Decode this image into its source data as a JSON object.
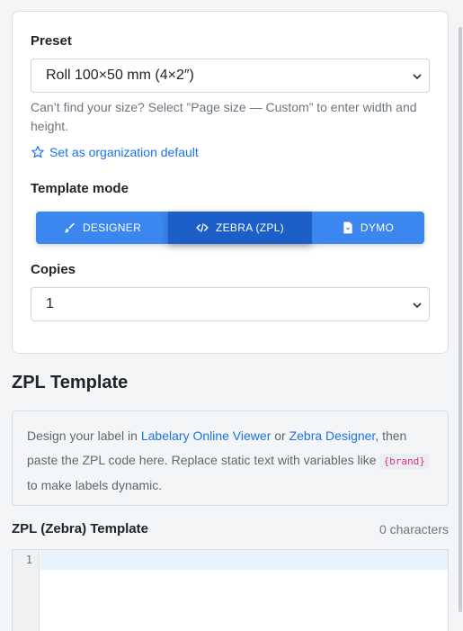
{
  "preset": {
    "label": "Preset",
    "selected": "Roll 100×50 mm (4×2″)",
    "help": "Can’t find your size? Select ”Page size — Custom” to enter width and height.",
    "default_link": "Set as organization default"
  },
  "template_mode": {
    "label": "Template mode",
    "options": [
      {
        "label": "DESIGNER",
        "icon": "brush-icon"
      },
      {
        "label": "ZEBRA (ZPL)",
        "icon": "code-icon"
      },
      {
        "label": "DYMO",
        "icon": "file-icon"
      }
    ],
    "active_index": 1
  },
  "copies": {
    "label": "Copies",
    "selected": "1"
  },
  "zpl_section": {
    "title": "ZPL Template",
    "info_pre": "Design your label in ",
    "link1": "Labelary Online Viewer",
    "info_mid": " or ",
    "link2": "Zebra Designer",
    "info_post": ", then paste the ZPL code here. Replace static text with variables like ",
    "variable": "{brand}",
    "info_end": " to make labels dynamic."
  },
  "editor": {
    "label": "ZPL (Zebra) Template",
    "char_count": "0 characters",
    "line_number": "1"
  },
  "colors": {
    "accent": "#3b86ef",
    "accent_active": "#1d5fc9",
    "link": "#1a73e8"
  }
}
